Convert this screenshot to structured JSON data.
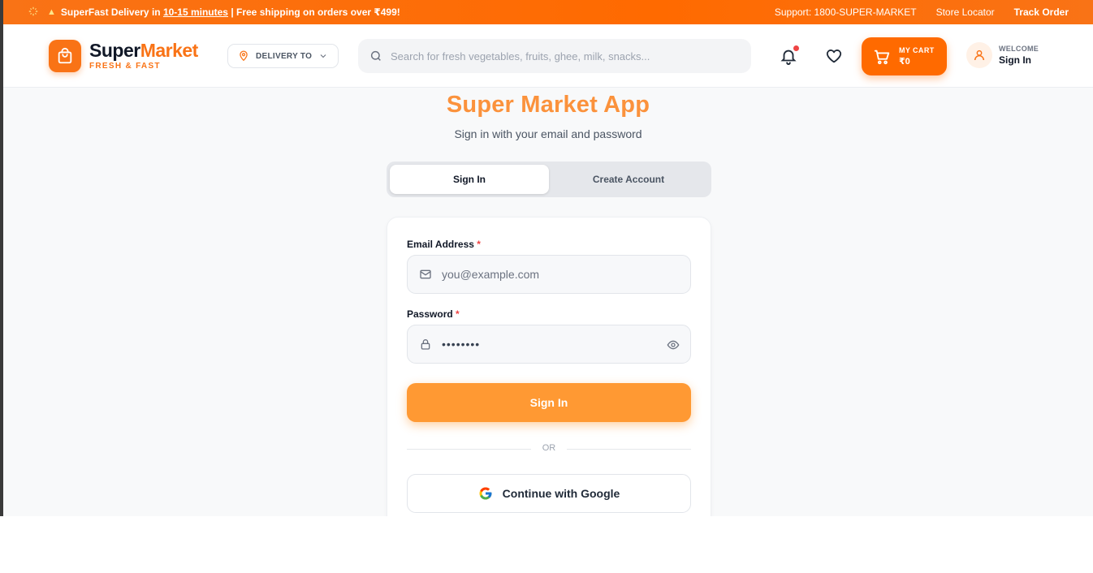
{
  "promo": {
    "text_a": "SuperFast Delivery in ",
    "text_b": "10-15 minutes",
    "text_c": " | Free shipping on orders over ₹499!",
    "support": "Support: 1800-SUPER-MARKET",
    "store_locator": "Store Locator",
    "track_order": "Track Order"
  },
  "header": {
    "brand_part1": "Super",
    "brand_part2": "Market",
    "tagline": "FRESH & FAST",
    "delivery_label": "DELIVERY TO",
    "search_placeholder": "Search for fresh vegetables, fruits, ghee, milk, snacks...",
    "cart_label": "MY CART",
    "cart_total": "₹0",
    "user_welcome": "WELCOME",
    "user_signin": "Sign In"
  },
  "auth": {
    "title": "Super Market App",
    "subtitle": "Sign in with your email and password",
    "tabs": [
      {
        "label": "Sign In",
        "active": true
      },
      {
        "label": "Create Account",
        "active": false
      }
    ],
    "email_label": "Email Address",
    "email_placeholder": "you@example.com",
    "password_label": "Password",
    "password_value": "••••••••",
    "required_mark": "*",
    "signin_button": "Sign In",
    "divider_text": "OR",
    "google_button": "Continue with Google"
  },
  "colors": {
    "accent": "#f97316",
    "cart": "#ff6a00",
    "signin_button": "#ff9933",
    "title": "#fb923c",
    "notification_dot": "#ef4444"
  }
}
